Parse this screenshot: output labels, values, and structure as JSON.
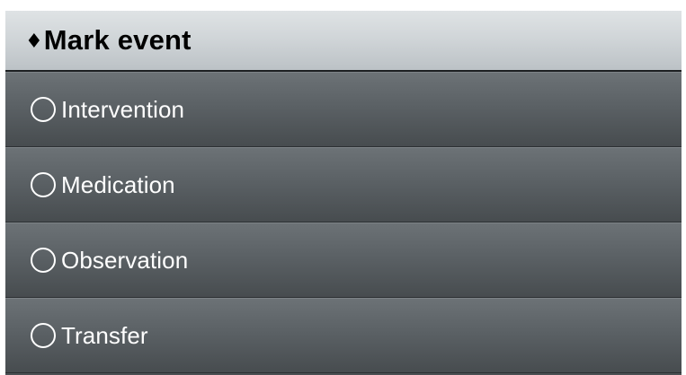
{
  "header": {
    "icon": "diamond-icon",
    "icon_glyph": "♦",
    "title": "Mark event"
  },
  "options": [
    {
      "label": "Intervention",
      "selected": false
    },
    {
      "label": "Medication",
      "selected": false
    },
    {
      "label": "Observation",
      "selected": false
    },
    {
      "label": "Transfer",
      "selected": false
    }
  ]
}
